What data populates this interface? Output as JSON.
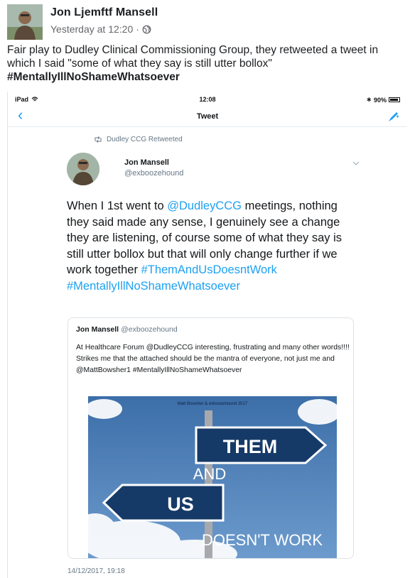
{
  "post": {
    "author": "Jon Ljemftf Mansell",
    "timestamp": "Yesterday at 12:20",
    "privacy_icon": "globe-icon",
    "text": "Fair play to Dudley Clinical Commissioning Group, they retweeted a tweet in which I said \"some of what they say is still utter bollox\"",
    "hashtag": "#MentallyIllNoShameWhatsoever"
  },
  "screenshot": {
    "status": {
      "carrier": "iPad",
      "time": "12:08",
      "battery": "90%"
    },
    "nav": {
      "title": "Tweet"
    },
    "retweet_label": "Dudley CCG Retweeted",
    "tweet": {
      "name": "Jon Mansell",
      "handle": "@exboozehound",
      "text_1": "When I 1st went to ",
      "mention": "@DudleyCCG",
      "text_2": " meetings, nothing they said made any sense, I genuinely see a change they are listening, of course some of what they say is still utter bollox but that will only change further if we work together ",
      "hashtag_1": "#ThemAndUsDoesntWork",
      "hashtag_2": "#MentallyIllNoShameWhatsoever",
      "date": "14/12/2017, 19:18"
    },
    "quoted": {
      "name": "Jon Mansell",
      "handle": "@exboozehound",
      "text": "At Healthcare Forum @DudleyCCG interesting, frustrating and many other words!!!! Strikes me that the attached should be the mantra of everyone, not just me and @MattBowsher1 #MentallyIllNoShameWhatsoever",
      "image": {
        "credit": "Matt Bowsher & exboozehound 2017",
        "sign_them": "THEM",
        "word_and": "AND",
        "sign_us": "US",
        "doesnt_work": "DOESN'T WORK"
      }
    }
  },
  "colors": {
    "twitter_blue": "#1da1f2",
    "sign_navy": "#163a67",
    "sky": "#4f80b6"
  }
}
